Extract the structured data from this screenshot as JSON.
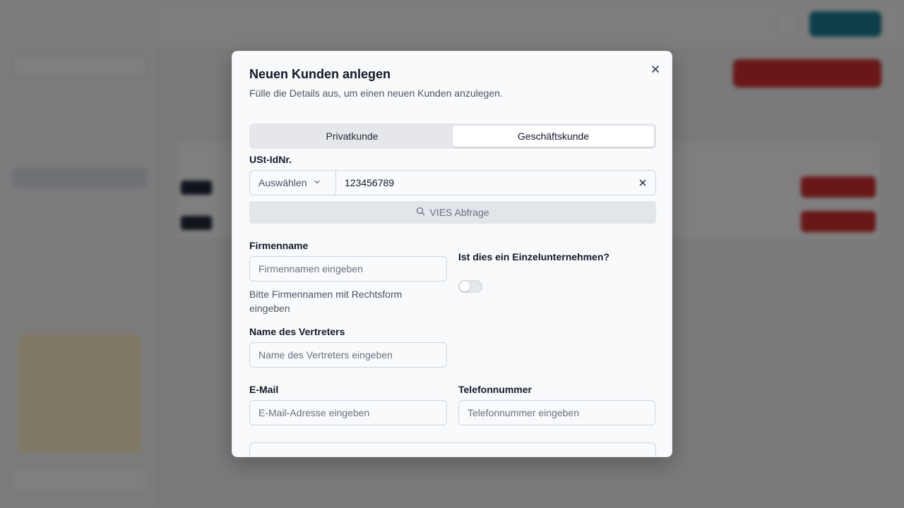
{
  "modal": {
    "title": "Neuen Kunden anlegen",
    "subtitle": "Fülle die Details aus, um einen neuen Kunden anzulegen.",
    "close_icon": "x-icon",
    "tabs": [
      {
        "label": "Privatkunde",
        "active": false
      },
      {
        "label": "Geschäftskunde",
        "active": true
      }
    ],
    "vat": {
      "label": "USt-IdNr.",
      "select_value": "Auswählen",
      "input_value": "123456789",
      "clear_icon": "x-icon"
    },
    "vies_button": {
      "label": "VIES Abfrage",
      "icon": "search-icon"
    },
    "company": {
      "label": "Firmenname",
      "placeholder": "Firmennamen eingeben",
      "helper": "Bitte Firmennamen mit Rechtsform eingeben"
    },
    "sole_proprietor": {
      "label": "Ist dies ein Einzelunternehmen?",
      "checked": false
    },
    "representative": {
      "label": "Name des Vertreters",
      "placeholder": "Name des Vertreters eingeben"
    },
    "email": {
      "label": "E-Mail",
      "placeholder": "E-Mail-Adresse eingeben"
    },
    "phone": {
      "label": "Telefonnummer",
      "placeholder": "Telefonnummer eingeben"
    }
  },
  "colors": {
    "overlay": "#808080",
    "accent_teal": "#1d7e97",
    "accent_red": "#d3302f",
    "modal_bg": "#f8fafc"
  }
}
